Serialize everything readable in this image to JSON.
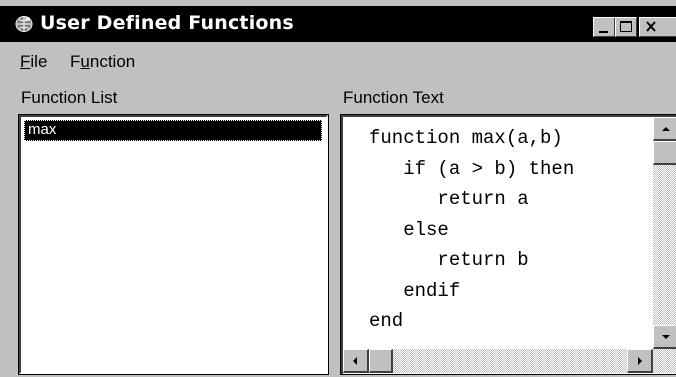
{
  "window": {
    "title": "User Defined Functions",
    "icon": "app-globe-icon",
    "controls": [
      "minimize-icon",
      "maximize-icon",
      "close-icon"
    ]
  },
  "menu": {
    "file": {
      "label": "File",
      "mnemonic_char": "F",
      "rest": "ile"
    },
    "function": {
      "label": "Function",
      "before": "F",
      "mnemonic_char": "u",
      "rest": "nction"
    }
  },
  "function_list": {
    "label": "Function List",
    "items": [
      {
        "name": "max",
        "selected": true
      }
    ]
  },
  "function_text": {
    "label": "Function Text",
    "code": "function max(a,b)\n   if (a > b) then\n      return a\n   else\n      return b\n   endif\nend"
  },
  "colors": {
    "title_bar": "#000000",
    "face": "#c0c0c0",
    "selection": "#000000",
    "field": "#ffffff"
  }
}
